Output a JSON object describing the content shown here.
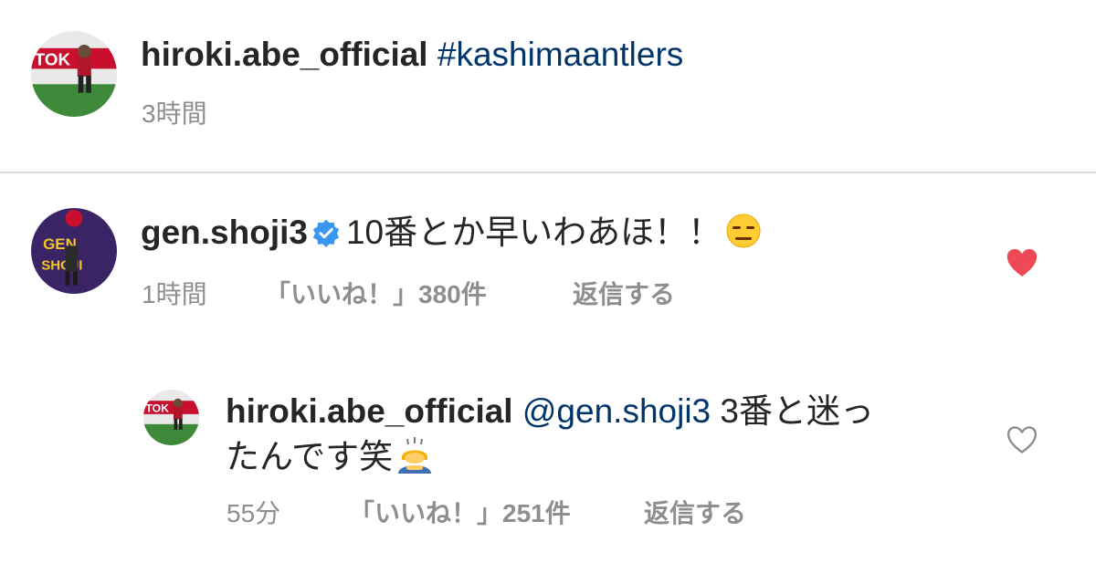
{
  "post": {
    "username": "hiroki.abe_official",
    "hashtag": "#kashimaantlers",
    "time": "3時間"
  },
  "comments": [
    {
      "username": "gen.shoji3",
      "verified": true,
      "text": "10番とか早いわあほ！！",
      "emoji": "expressionless-face-emoji",
      "time": "1時間",
      "likes": "「いいね！」380件",
      "reply_label": "返信する",
      "liked": true,
      "like_color": "#ed4956"
    }
  ],
  "replies": [
    {
      "username": "hiroki.abe_official",
      "mention": "@gen.shoji3",
      "text_line1": "3番と迷っ",
      "text_line2": "たんです笑",
      "emoji": "person-bowing-emoji",
      "time": "55分",
      "likes": "「いいね！」251件",
      "reply_label": "返信する",
      "liked": false
    }
  ],
  "colors": {
    "hashtag": "#003569",
    "meta": "#8e8e8e",
    "verified": "#3897f0",
    "heart_liked": "#ed4956",
    "heart_outline": "#8e8e8e"
  }
}
